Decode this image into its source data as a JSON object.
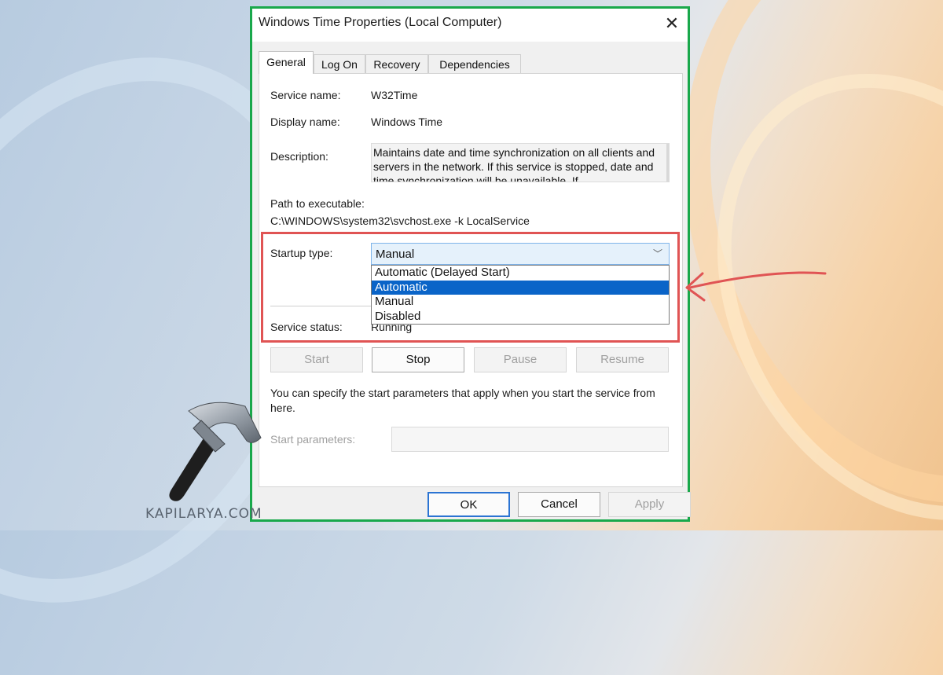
{
  "window": {
    "title": "Windows Time Properties (Local Computer)",
    "close_icon": "close-icon"
  },
  "tabs": [
    {
      "label": "General",
      "active": true
    },
    {
      "label": "Log On",
      "active": false
    },
    {
      "label": "Recovery",
      "active": false
    },
    {
      "label": "Dependencies",
      "active": false
    }
  ],
  "general": {
    "service_name_label": "Service name:",
    "service_name": "W32Time",
    "display_name_label": "Display name:",
    "display_name": "Windows Time",
    "description_label": "Description:",
    "description": "Maintains date and time synchronization on all clients and servers in the network. If this service is stopped, date and time synchronization will be unavailable. If",
    "path_label": "Path to executable:",
    "path": "C:\\WINDOWS\\system32\\svchost.exe -k LocalService",
    "startup_type_label": "Startup type:",
    "startup_type": "Manual",
    "startup_options": [
      "Automatic (Delayed Start)",
      "Automatic",
      "Manual",
      "Disabled"
    ],
    "highlighted_option": "Automatic",
    "service_status_label": "Service status:",
    "service_status": "Running",
    "buttons": {
      "start": "Start",
      "stop": "Stop",
      "pause": "Pause",
      "resume": "Resume"
    },
    "info_text": "You can specify the start parameters that apply when you start the service from here.",
    "start_params_label": "Start parameters:",
    "start_params_value": ""
  },
  "footer": {
    "ok": "OK",
    "cancel": "Cancel",
    "apply": "Apply"
  },
  "watermark": "KAPILARYA.COM",
  "colors": {
    "dialog_border": "#19a84b",
    "highlight_box": "#e05454",
    "selected_option": "#0a64c8",
    "arrow": "#e05454"
  }
}
